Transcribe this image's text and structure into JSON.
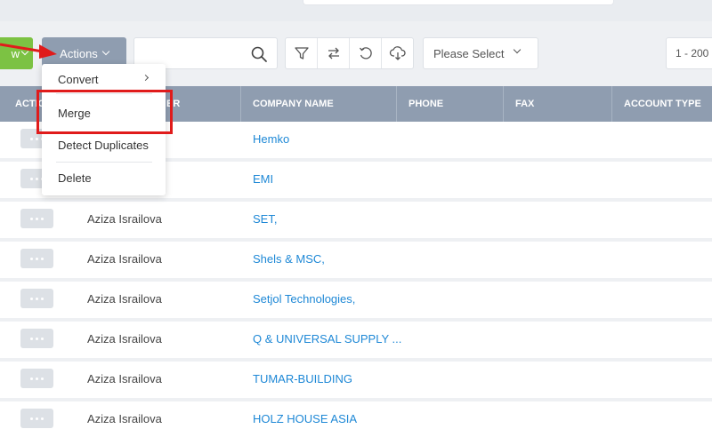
{
  "toolbar": {
    "new_label": "w",
    "actions_label": "Actions",
    "search_placeholder": "",
    "select_value": "Please Select",
    "pager_text": "1 - 200"
  },
  "actions_menu": {
    "items": [
      {
        "label": "Convert",
        "has_submenu": true
      },
      {
        "label": "Merge",
        "highlighted": true
      },
      {
        "label": "Detect Duplicates"
      },
      {
        "label": "Delete"
      }
    ]
  },
  "table": {
    "columns": [
      "ACTIONS",
      "OWNER",
      "COMPANY NAME",
      "PHONE",
      "FAX",
      "ACCOUNT TYPE"
    ],
    "visible_headers": {
      "actions": "ACTIO",
      "owner": "ER",
      "company": "COMPANY NAME",
      "phone": "PHONE",
      "fax": "FAX",
      "account_type": "ACCOUNT TYPE"
    },
    "rows": [
      {
        "owner": "",
        "company": "Hemko"
      },
      {
        "owner": "",
        "company": "EMI"
      },
      {
        "owner": "Aziza Israilova",
        "company": "SET,"
      },
      {
        "owner": "Aziza Israilova",
        "company": "Shels & MSC,"
      },
      {
        "owner": "Aziza Israilova",
        "company": "Setjol Technologies,"
      },
      {
        "owner": "Aziza Israilova",
        "company": "Q & UNIVERSAL SUPPLY ..."
      },
      {
        "owner": "Aziza Israilova",
        "company": "TUMAR-BUILDING"
      },
      {
        "owner": "Aziza Israilova",
        "company": "HOLZ HOUSE ASIA"
      }
    ]
  },
  "colors": {
    "accent_green": "#7cc243",
    "header_gray": "#8f9db0",
    "link_blue": "#1e88d6",
    "annotation_red": "#e01b1b"
  }
}
